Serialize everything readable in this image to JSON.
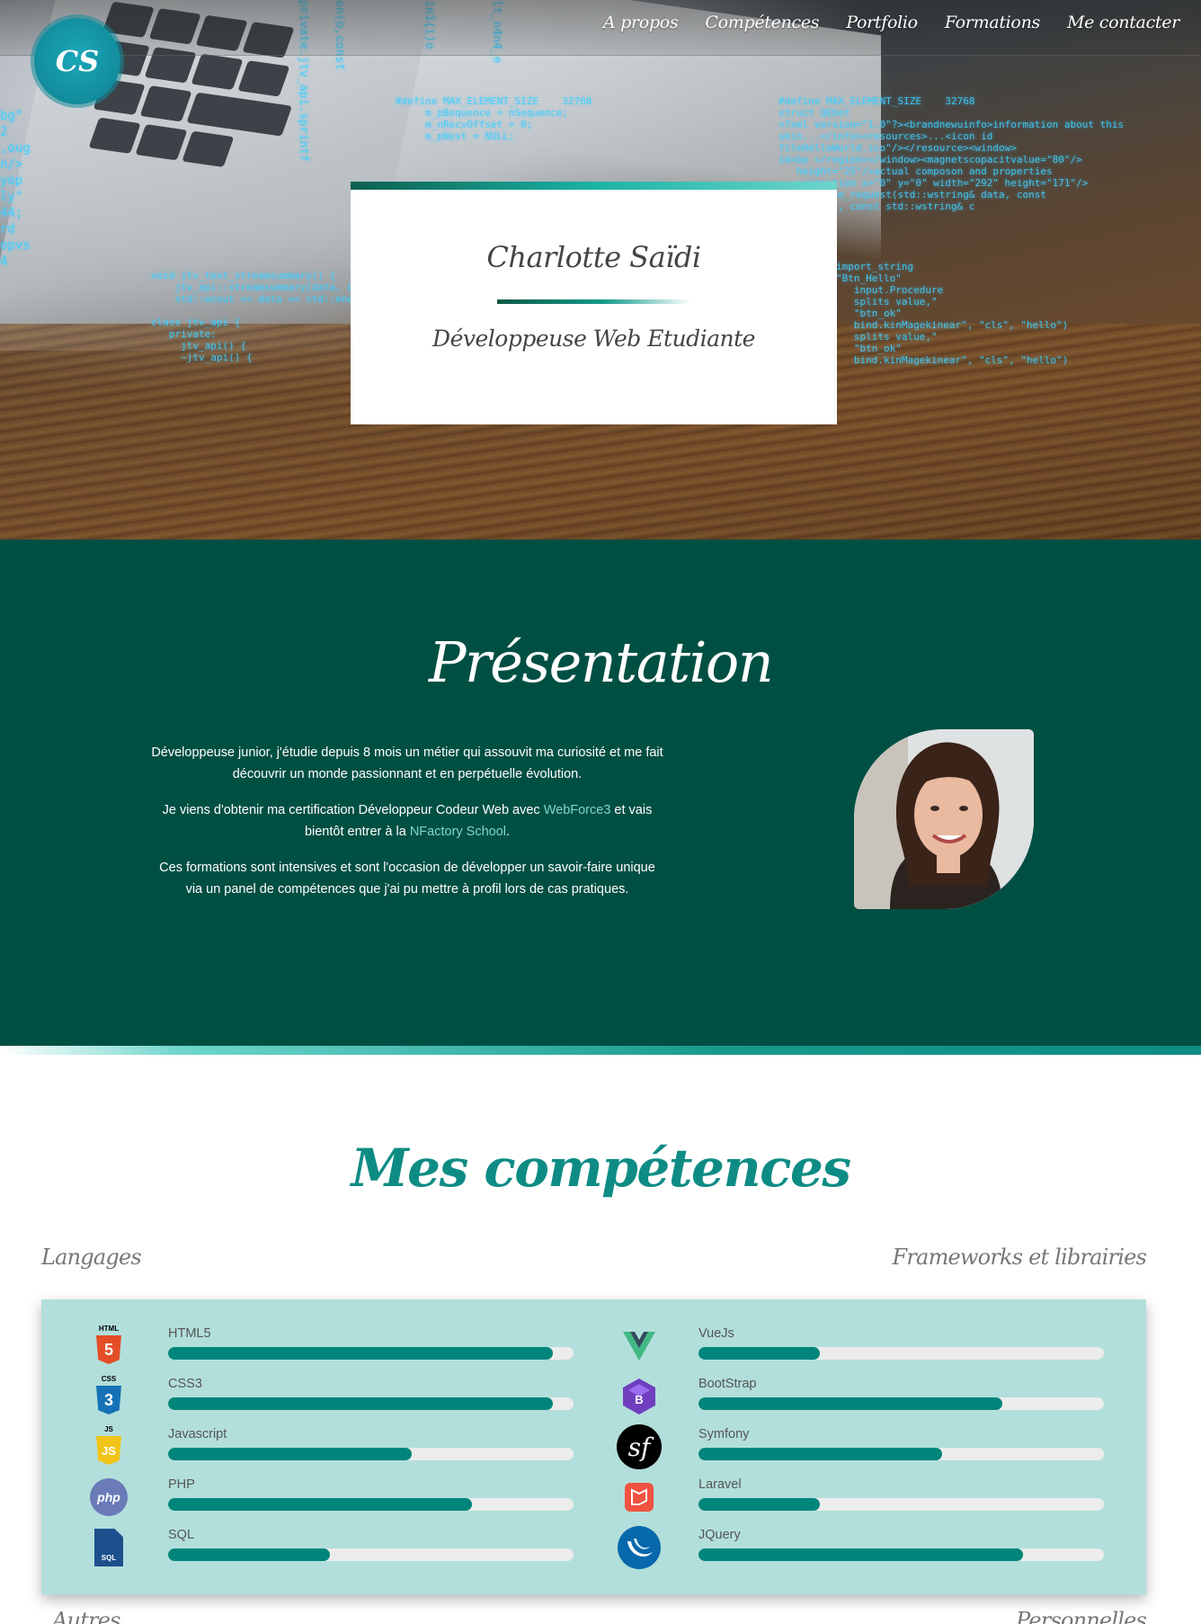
{
  "brand": {
    "logo_text": "CS"
  },
  "nav": {
    "items": [
      "A propos",
      "Compétences",
      "Portfolio",
      "Formations",
      "Me contacter"
    ]
  },
  "hero": {
    "name": "Charlotte Saïdi",
    "role": "Développeuse Web Etudiante"
  },
  "presentation": {
    "title": "Présentation",
    "p1": "Développeuse junior, j'étudie depuis 8 mois un métier qui assouvit ma curiosité et me fait découvrir un monde passionnant et en perpétuelle évolution.",
    "p2_before": "Je viens d'obtenir ma certification Développeur Codeur Web avec ",
    "p2_link1": "WebForce3",
    "p2_middle": " et vais bientôt entrer à la ",
    "p2_link2": "NFactory School",
    "p2_after": ".",
    "p3": "Ces formations sont intensives et sont l'occasion de développer un savoir-faire unique via un panel de compétences que j'ai pu mettre à profil lors de cas pratiques."
  },
  "skills": {
    "title": "Mes compétences",
    "languages_label": "Langages",
    "frameworks_label": "Frameworks et librairies",
    "others_label": "Autres",
    "personal_label": "Personnelles",
    "languages": [
      {
        "name": "HTML5",
        "level": 0.95,
        "icon": "html5-icon",
        "tag": "HTML",
        "glyph": "5",
        "color": "#e44d26"
      },
      {
        "name": "CSS3",
        "level": 0.95,
        "icon": "css3-icon",
        "tag": "CSS",
        "glyph": "3",
        "color": "#1572b6"
      },
      {
        "name": "Javascript",
        "level": 0.6,
        "icon": "javascript-icon",
        "tag": "JS",
        "glyph": "JS",
        "color": "#f0c419"
      },
      {
        "name": "PHP",
        "level": 0.75,
        "icon": "php-icon",
        "tag": "",
        "glyph": "php",
        "color": "#6a7bb8"
      },
      {
        "name": "SQL",
        "level": 0.4,
        "icon": "sql-icon",
        "tag": "",
        "glyph": "SQL",
        "color": "#1c4f8c"
      }
    ],
    "frameworks": [
      {
        "name": "VueJs",
        "level": 0.3,
        "icon": "vuejs-icon",
        "color": "#41b883"
      },
      {
        "name": "BootStrap",
        "level": 0.75,
        "icon": "bootstrap-icon",
        "color": "#6f3fbf"
      },
      {
        "name": "Symfony",
        "level": 0.6,
        "icon": "symfony-icon",
        "color": "#000000"
      },
      {
        "name": "Laravel",
        "level": 0.3,
        "icon": "laravel-icon",
        "color": "#f05340"
      },
      {
        "name": "JQuery",
        "level": 0.8,
        "icon": "jquery-icon",
        "color": "#0868ac"
      }
    ]
  },
  "colors": {
    "primary": "#004f43",
    "accent": "#0e8c84",
    "panel": "#b2dfdb"
  }
}
